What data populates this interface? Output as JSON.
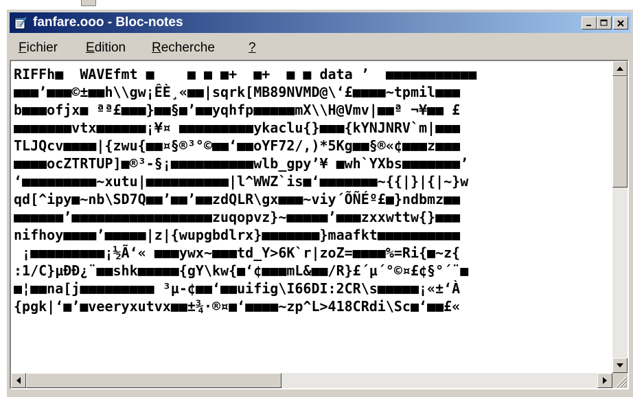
{
  "window": {
    "title": "fanfare.ooo - Bloc-notes",
    "icon": "notepad-icon"
  },
  "title_buttons": {
    "minimize": "minimize-icon",
    "maximize": "maximize-icon",
    "close": "close-icon"
  },
  "menu": {
    "items": [
      {
        "mnemonic": "F",
        "rest": "ichier"
      },
      {
        "mnemonic": "E",
        "rest": "dition"
      },
      {
        "mnemonic": "R",
        "rest": "echerche"
      },
      {
        "mnemonic": "?",
        "rest": ""
      }
    ]
  },
  "document": {
    "lines": [
      "RIFFh■  WAVEfmt ■    ■ ■ ■+  ■+  ■ ■ data ’  ■■■■■■■■■■■",
      "■■■’■■■©±■■h\\\\gw¡ÊÈ¸«■■|sqrk[MB89NVMD@\\‘£■■■■~tpmil■■■",
      "b■■■ofjx■ ªª£■■■}■■§■’■■yqhfp■■■■■mX\\\\H@Vmv|■■ª ¬¥■■ £",
      "■■■■■■■vtx■■■■■■¡¥¤ ■■■■■■■■■ykaclu{}■■■{kYNJNRV`m|■■■",
      "TLJQcv■■■■|{zwu{■■¤§®³°©■■‘■■oYF72/,)*5Kg■■§®«¢■■■z■■■",
      "■■■■ocZTRTUP]■®³-§¡■■■■■■■■■■wlb_gpy’¥ ■wh`YXbs■■■■■■■’",
      "‘■■■■■■■■■~xutu|■■■■■■■■■■|l^WWZ`is■‘■■■■■■■~{{|}|{|~}w",
      "qd[^ipy■~nb\\SD7Q■■’■■’■■zdQLR\\gx■■■~viy´ÕÑÉº£■}ndbmz■■",
      "■■■■■■’■■■■■■■■■■■■■■■■■zuqopvz}~■■■■■’■■■zxxwttw{}■■■",
      "nifhoy■■■■’■■■■■|z|{wupgbdlrx}■■■■■■■}maafkt■■■■■■■■■■",
      " ¡■■■■■■■■■¡½Ã‘« ■■■ywx~■■■td_Y>6K`r|zoZ=■■■■%=Ri{■~z{",
      ":1/C}µÐÐ¿¨■■shk■■■■■{gY\\kw{■‘¢■■■mL&■■/R}£´µ´°©¤£¢§°´¨■",
      "■¦■■na[j■■■■■■■■■ ³µ-¢■■‘■■uifig\\I66DI:2CR\\s■■■■■¡«±‘À",
      "{pgk|‘■’■veeryxutvx■■±¾·®¤■‘■■■■~zp^L>418CRdi\\Sc■‘■■£«"
    ]
  },
  "scrollbars": {
    "up": "scroll-up-arrow-icon",
    "down": "scroll-down-arrow-icon",
    "left": "scroll-left-arrow-icon",
    "right": "scroll-right-arrow-icon",
    "grip": "resize-grip-icon"
  }
}
